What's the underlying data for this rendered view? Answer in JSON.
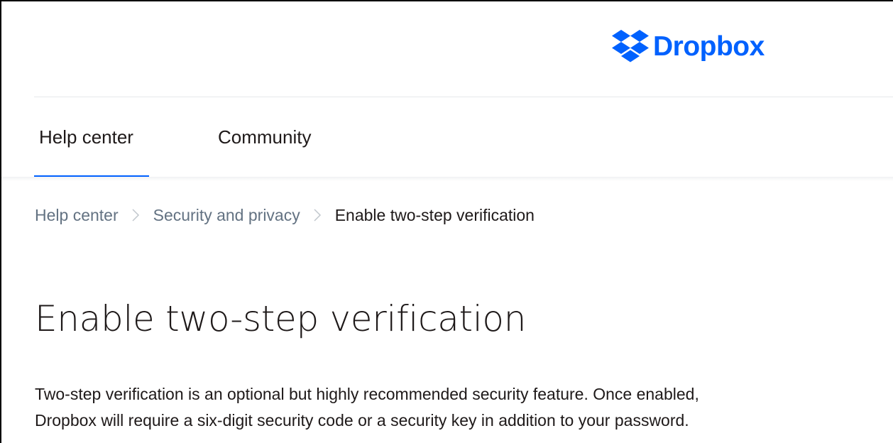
{
  "header": {
    "logo_text": "Dropbox",
    "logo_icon": "dropbox-logo-icon",
    "brand_color": "#0061fe"
  },
  "nav": {
    "tabs": [
      {
        "label": "Help center",
        "active": true
      },
      {
        "label": "Community",
        "active": false
      }
    ]
  },
  "breadcrumb": {
    "items": [
      "Help center",
      "Security and privacy",
      "Enable two-step verification"
    ],
    "separator_icon": "chevron-right-icon"
  },
  "article": {
    "title": "Enable two-step verification",
    "intro_line1": "Two-step verification is an optional but highly recommended security feature. Once enabled,",
    "intro_line2": "Dropbox will require a six-digit security code or a security key in addition to your password."
  }
}
